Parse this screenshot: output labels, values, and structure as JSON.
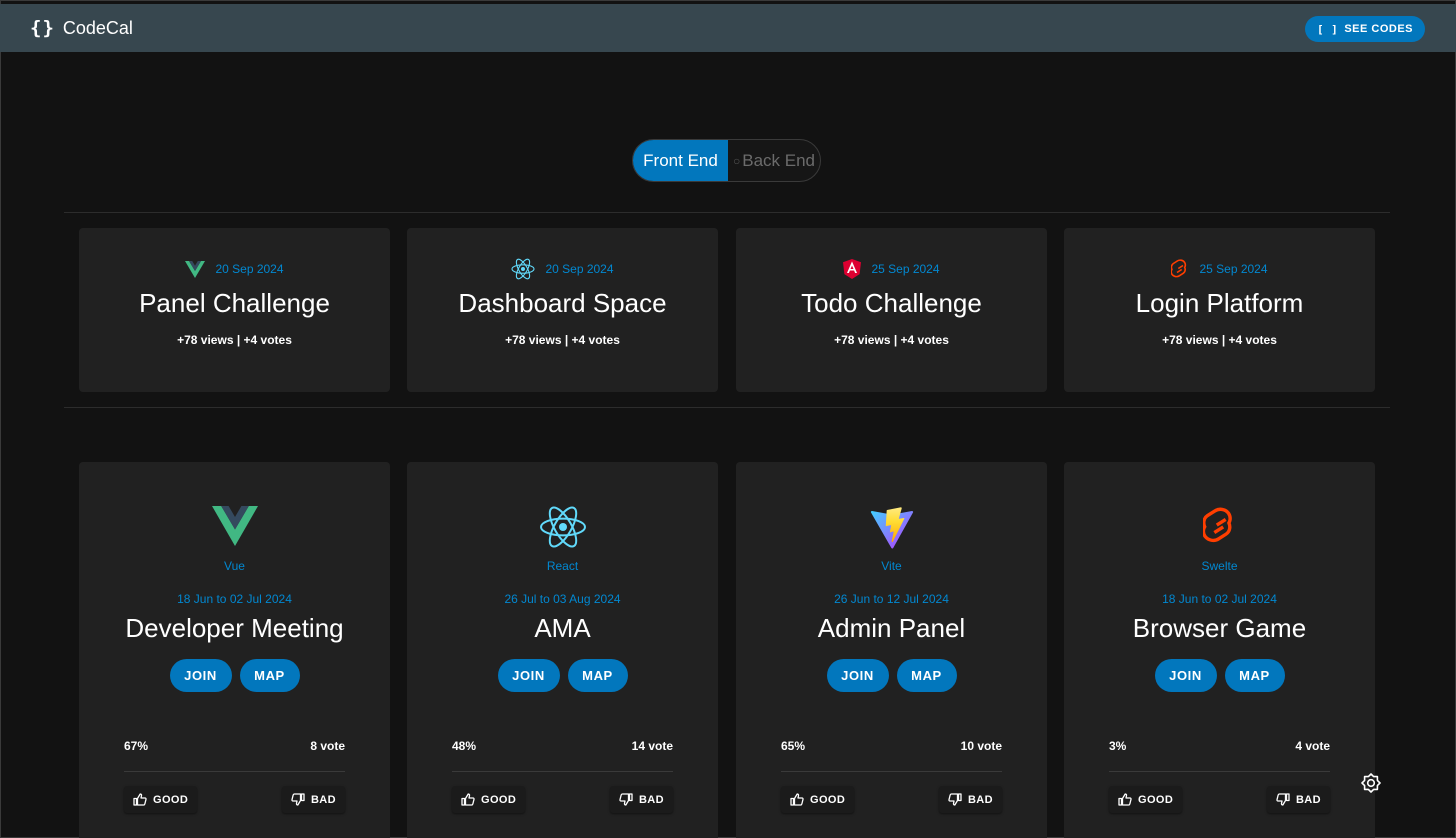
{
  "appbar": {
    "logo_glyph": "{}",
    "title": "CodeCal",
    "see_codes_icon": "[ ]",
    "see_codes_label": "SEE CODES"
  },
  "toggle": {
    "active_label": "Front End",
    "inactive_label": "Back End"
  },
  "summary_cards": [
    {
      "icon": "vue-icon",
      "date": "20 Sep 2024",
      "title": "Panel Challenge",
      "stats": "+78 views | +4 votes"
    },
    {
      "icon": "react-icon",
      "date": "20 Sep 2024",
      "title": "Dashboard Space",
      "stats": "+78 views | +4 votes"
    },
    {
      "icon": "angular-icon",
      "date": "25 Sep 2024",
      "title": "Todo Challenge",
      "stats": "+78 views | +4 votes"
    },
    {
      "icon": "svelte-icon",
      "date": "25 Sep 2024",
      "title": "Login Platform",
      "stats": "+78 views | +4 votes"
    }
  ],
  "event_cards": [
    {
      "icon": "vue-icon",
      "tech": "Vue",
      "range": "18 Jun to 02 Jul 2024",
      "title": "Developer Meeting",
      "join": "JOIN",
      "map": "MAP",
      "percent": "67%",
      "votes": "8 vote",
      "good": "GOOD",
      "bad": "BAD"
    },
    {
      "icon": "react-icon",
      "tech": "React",
      "range": "26 Jul to 03 Aug 2024",
      "title": "AMA",
      "join": "JOIN",
      "map": "MAP",
      "percent": "48%",
      "votes": "14 vote",
      "good": "GOOD",
      "bad": "BAD"
    },
    {
      "icon": "vite-icon",
      "tech": "Vite",
      "range": "26 Jun to 12 Jul 2024",
      "title": "Admin Panel",
      "join": "JOIN",
      "map": "MAP",
      "percent": "65%",
      "votes": "10 vote",
      "good": "GOOD",
      "bad": "BAD"
    },
    {
      "icon": "svelte-icon",
      "tech": "Swelte",
      "range": "18 Jun to 02 Jul 2024",
      "title": "Browser Game",
      "join": "JOIN",
      "map": "MAP",
      "percent": "3%",
      "votes": "4 vote",
      "good": "GOOD",
      "bad": "BAD"
    }
  ],
  "colors": {
    "accent": "#0277bd",
    "date_text": "#0288d1",
    "appbar": "#37474f",
    "card": "#212121",
    "background": "#121212",
    "vue_green": "#41b883",
    "vue_dark": "#34495e",
    "react_blue": "#61dafb",
    "angular_red": "#dd0031",
    "svelte_red": "#ff3e00"
  }
}
